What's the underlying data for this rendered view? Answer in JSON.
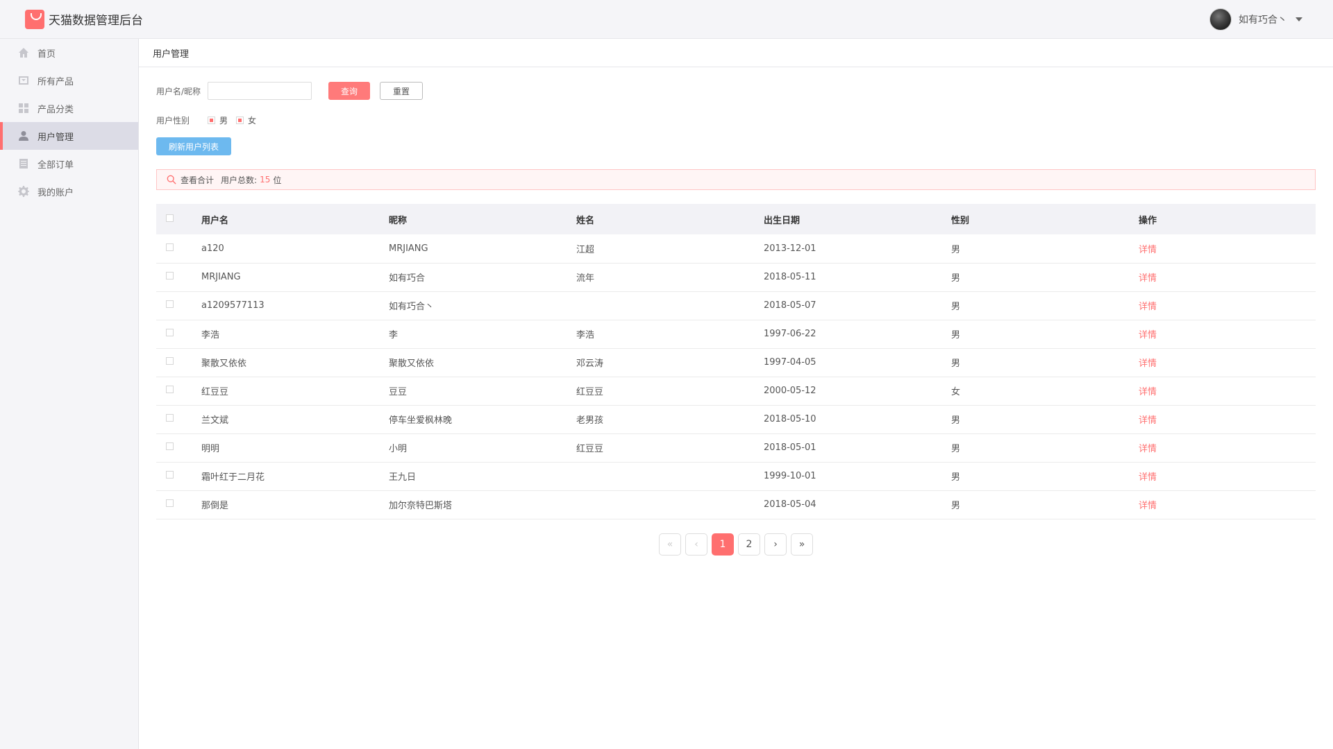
{
  "header": {
    "title": "天猫数据管理后台",
    "user_name": "如有巧合丶"
  },
  "sidebar": {
    "items": [
      {
        "label": "首页",
        "icon": "home-icon"
      },
      {
        "label": "所有产品",
        "icon": "product-icon"
      },
      {
        "label": "产品分类",
        "icon": "category-icon"
      },
      {
        "label": "用户管理",
        "icon": "user-icon",
        "active": true
      },
      {
        "label": "全部订单",
        "icon": "order-icon"
      },
      {
        "label": "我的账户",
        "icon": "gear-icon"
      }
    ]
  },
  "breadcrumb": "用户管理",
  "filters": {
    "username_label": "用户名/昵称",
    "username_value": "",
    "query_label": "查询",
    "reset_label": "重置",
    "gender_label": "用户性别",
    "male_label": "男",
    "female_label": "女",
    "male_checked": true,
    "female_checked": true,
    "refresh_label": "刷新用户列表"
  },
  "summary": {
    "view_label": "查看合计",
    "total_label": "用户总数:",
    "total_count": "15",
    "unit": "位"
  },
  "table": {
    "headers": [
      "用户名",
      "昵称",
      "姓名",
      "出生日期",
      "性别",
      "操作"
    ],
    "rows": [
      {
        "username": "a120",
        "nickname": "MRJIANG",
        "name": "江超",
        "birth": "2013-12-01",
        "gender": "男",
        "action": "详情"
      },
      {
        "username": "MRJIANG",
        "nickname": "如有巧合",
        "name": "流年",
        "birth": "2018-05-11",
        "gender": "男",
        "action": "详情"
      },
      {
        "username": "a1209577113",
        "nickname": "如有巧合丶",
        "name": "",
        "birth": "2018-05-07",
        "gender": "男",
        "action": "详情"
      },
      {
        "username": "李浩",
        "nickname": "李",
        "name": "李浩",
        "birth": "1997-06-22",
        "gender": "男",
        "action": "详情"
      },
      {
        "username": "聚散又依依",
        "nickname": "聚散又依依",
        "name": "邓云涛",
        "birth": "1997-04-05",
        "gender": "男",
        "action": "详情"
      },
      {
        "username": "红豆豆",
        "nickname": "豆豆",
        "name": "红豆豆",
        "birth": "2000-05-12",
        "gender": "女",
        "action": "详情"
      },
      {
        "username": "兰文斌",
        "nickname": "停车坐爱枫林晚",
        "name": "老男孩",
        "birth": "2018-05-10",
        "gender": "男",
        "action": "详情"
      },
      {
        "username": "明明",
        "nickname": "小明",
        "name": "红豆豆",
        "birth": "2018-05-01",
        "gender": "男",
        "action": "详情"
      },
      {
        "username": "霜叶红于二月花",
        "nickname": "王九日",
        "name": "",
        "birth": "1999-10-01",
        "gender": "男",
        "action": "详情"
      },
      {
        "username": "那倒是",
        "nickname": "加尔奈特巴斯塔",
        "name": "",
        "birth": "2018-05-04",
        "gender": "男",
        "action": "详情"
      }
    ]
  },
  "pagination": {
    "first": "«",
    "prev": "‹",
    "pages": [
      "1",
      "2"
    ],
    "current": "1",
    "next": "›",
    "last": "»"
  },
  "colors": {
    "accent": "#ff6f6f",
    "refresh_button": "#6db9ef",
    "sidebar_bg": "#f5f5f8"
  }
}
